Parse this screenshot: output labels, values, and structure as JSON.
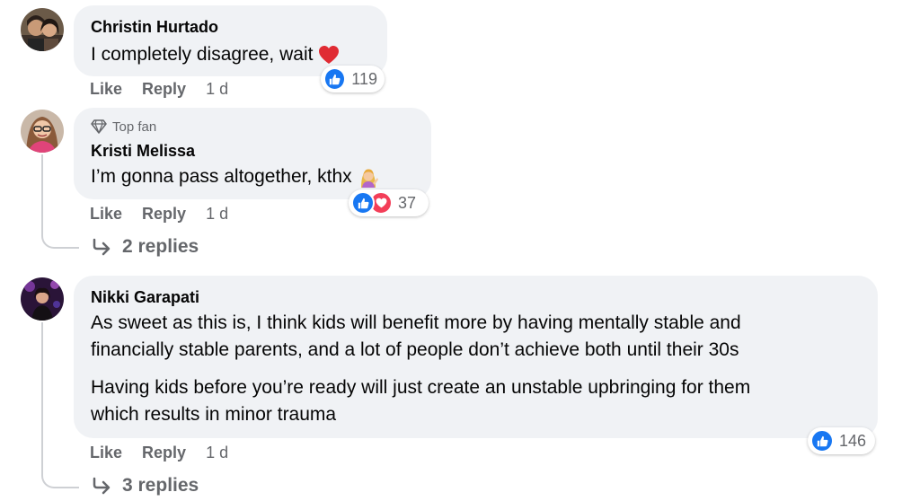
{
  "comments": [
    {
      "author": "Christin Hurtado",
      "text_lines": [
        "I completely disagree, wait"
      ],
      "emoji_icon": "red-heart-emoji",
      "actions": {
        "like": "Like",
        "reply": "Reply",
        "time": "1 d"
      },
      "reactions": {
        "types": [
          "like"
        ],
        "count": "119"
      }
    },
    {
      "badge": {
        "icon": "diamond-icon",
        "label": "Top fan"
      },
      "author": "Kristi Melissa",
      "text_lines": [
        "I’m gonna pass altogether, kthx"
      ],
      "emoji_icon": "tipping-hand-woman-emoji",
      "actions": {
        "like": "Like",
        "reply": "Reply",
        "time": "1 d"
      },
      "reactions": {
        "types": [
          "like",
          "love"
        ],
        "count": "37"
      },
      "replies": {
        "icon": "reply-arrow-icon",
        "label": "2 replies"
      }
    },
    {
      "author": "Nikki Garapati",
      "paragraphs": [
        [
          "As sweet as this is, I think kids will benefit more by having mentally stable and",
          "financially stable parents, and a lot of people don’t achieve both until their 30s"
        ],
        [
          "Having kids before you’re ready will just create an unstable upbringing for them",
          "which results in minor trauma"
        ]
      ],
      "actions": {
        "like": "Like",
        "reply": "Reply",
        "time": "1 d"
      },
      "reactions": {
        "types": [
          "like"
        ],
        "count": "146"
      },
      "replies": {
        "icon": "reply-arrow-icon",
        "label": "3 replies"
      }
    }
  ],
  "colors": {
    "bubble": "#f0f2f5",
    "secondary_text": "#65676b",
    "like_blue": "#1877f2",
    "love_red": "#f33e58",
    "thread_line": "#ced0d4"
  }
}
